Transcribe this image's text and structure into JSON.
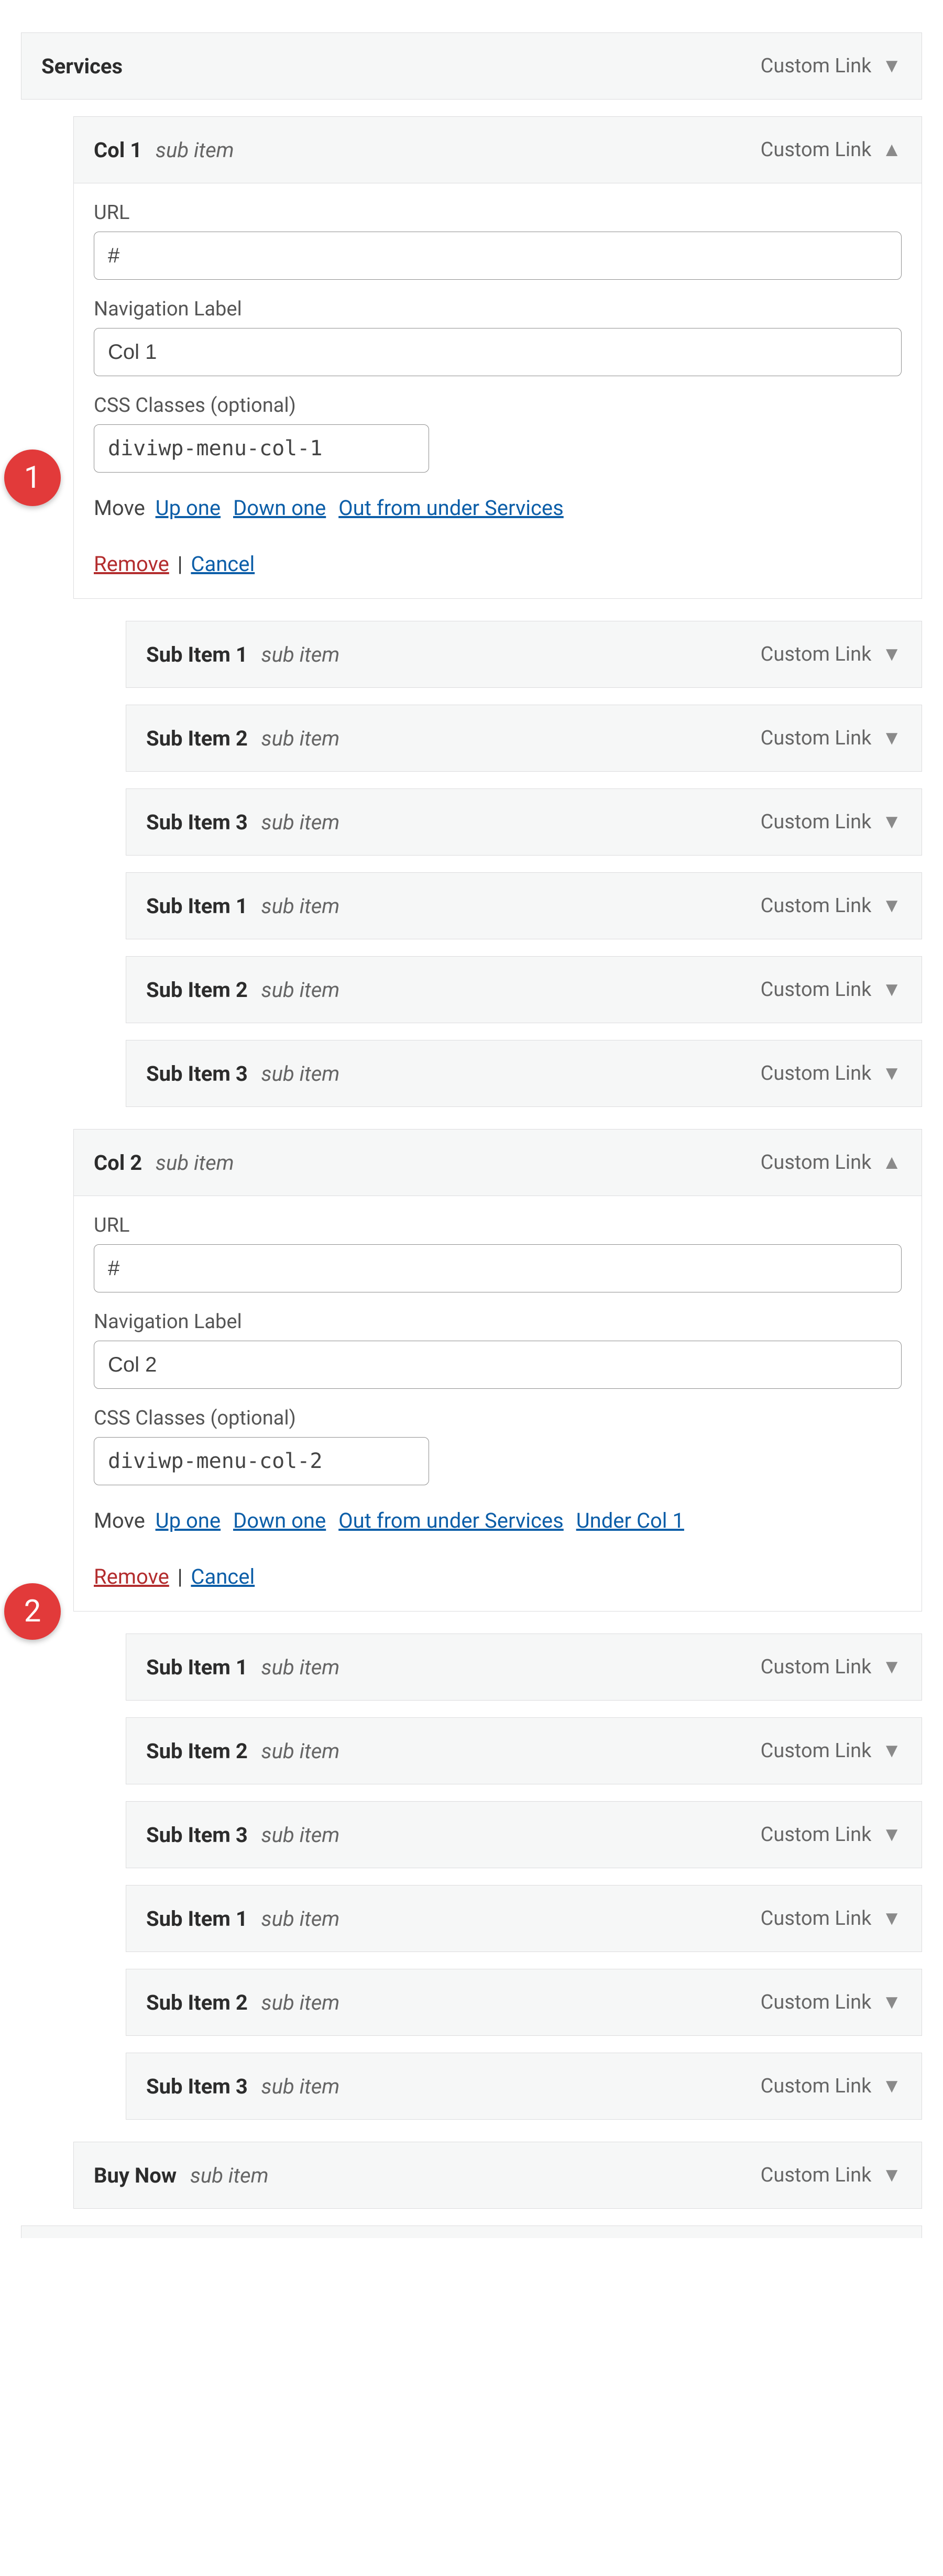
{
  "linktype": "Custom Link",
  "sub_item": "sub item",
  "labels": {
    "url": "URL",
    "nav_label": "Navigation Label",
    "css_classes": "CSS Classes (optional)",
    "move": "Move",
    "up_one": "Up one",
    "down_one": "Down one",
    "out_from": "Out from under Services",
    "under_col1": "Under Col 1",
    "remove": "Remove",
    "cancel": "Cancel"
  },
  "items": {
    "services": {
      "title": "Services"
    },
    "col1": {
      "title": "Col 1",
      "url": "#",
      "nav_label": "Col 1",
      "css_classes": "diviwp-menu-col-1"
    },
    "col2": {
      "title": "Col 2",
      "url": "#",
      "nav_label": "Col 2",
      "css_classes": "diviwp-menu-col-2"
    },
    "buy_now": {
      "title": "Buy Now"
    },
    "sub1": "Sub Item 1",
    "sub2": "Sub Item 2",
    "sub3": "Sub Item 3"
  },
  "callouts": {
    "one": "1",
    "two": "2"
  }
}
